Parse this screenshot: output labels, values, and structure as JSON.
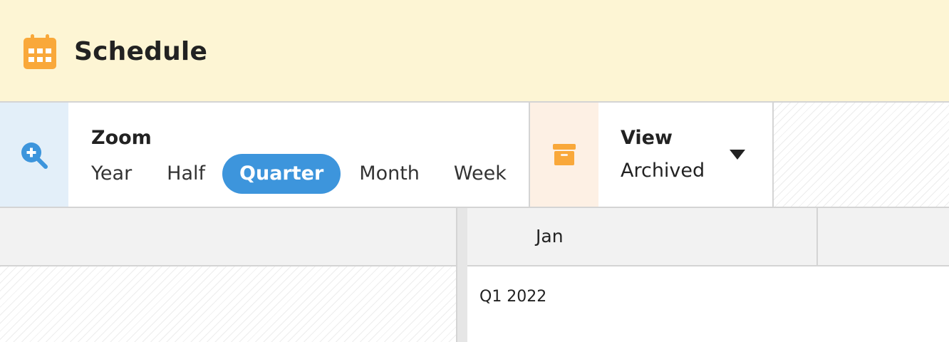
{
  "app": {
    "title": "Schedule",
    "icon": "calendar-icon",
    "accent_color": "#f9a83a",
    "header_bg": "#fdf5d4"
  },
  "toolbar": {
    "zoom": {
      "icon": "zoom-in-icon",
      "label": "Zoom",
      "options": [
        "Year",
        "Half",
        "Quarter",
        "Month",
        "Week"
      ],
      "selected": "Quarter",
      "selected_color": "#3d95dc"
    },
    "view": {
      "icon": "archive-icon",
      "label": "View",
      "value": "Archived"
    }
  },
  "timeline": {
    "months": [
      "Jan"
    ],
    "periods": [
      "Q1 2022"
    ]
  }
}
